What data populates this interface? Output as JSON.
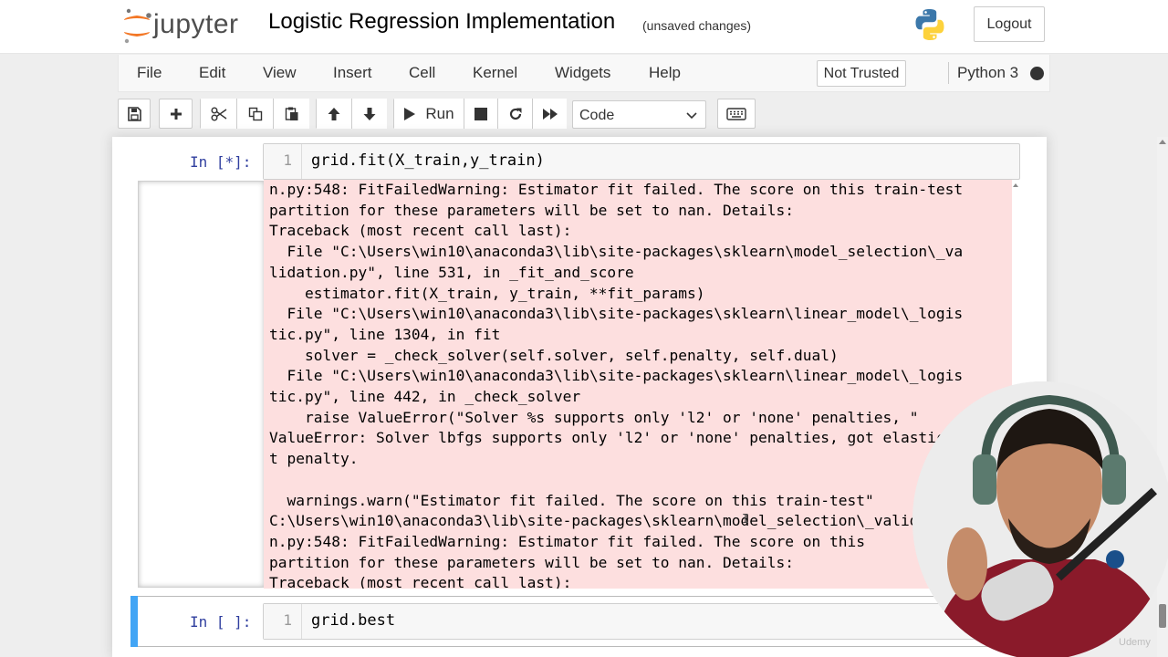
{
  "header": {
    "logo_text": "jupyter",
    "notebook_title": "Logistic Regression Implementation",
    "save_status": "(unsaved changes)",
    "logout_label": "Logout"
  },
  "menubar": {
    "items": [
      "File",
      "Edit",
      "View",
      "Insert",
      "Cell",
      "Kernel",
      "Widgets",
      "Help"
    ],
    "trust_label": "Not Trusted",
    "kernel_name": "Python 3",
    "kernel_status": "busy"
  },
  "toolbar": {
    "buttons": [
      "save-icon",
      "plus-icon",
      "cut-icon",
      "copy-icon",
      "paste-icon",
      "arrow-up-icon",
      "arrow-down-icon",
      "play-icon",
      "stop-icon",
      "restart-icon",
      "fast-forward-icon",
      "keyboard-icon"
    ],
    "run_label": "Run",
    "cell_type": "Code"
  },
  "cells": [
    {
      "prompt": "In [*]:",
      "line_number": "1",
      "code": "grid.fit(X_train,y_train)",
      "stderr": "n.py:548: FitFailedWarning: Estimator fit failed. The score on this train-test\npartition for these parameters will be set to nan. Details:\nTraceback (most recent call last):\n  File \"C:\\Users\\win10\\anaconda3\\lib\\site-packages\\sklearn\\model_selection\\_va\nlidation.py\", line 531, in _fit_and_score\n    estimator.fit(X_train, y_train, **fit_params)\n  File \"C:\\Users\\win10\\anaconda3\\lib\\site-packages\\sklearn\\linear_model\\_logis\ntic.py\", line 1304, in fit\n    solver = _check_solver(self.solver, self.penalty, self.dual)\n  File \"C:\\Users\\win10\\anaconda3\\lib\\site-packages\\sklearn\\linear_model\\_logis\ntic.py\", line 442, in _check_solver\n    raise ValueError(\"Solver %s supports only 'l2' or 'none' penalties, \"\nValueError: Solver lbfgs supports only 'l2' or 'none' penalties, got elastic\nt penalty.\n\n  warnings.warn(\"Estimator fit failed. The score on this train-test\"\nC:\\Users\\win10\\anaconda3\\lib\\site-packages\\sklearn\\model_selection\\_valida\nn.py:548: FitFailedWarning: Estimator fit failed. The score on this\npartition for these parameters will be set to nan. Details:\nTraceback (most recent call last):"
    },
    {
      "prompt": "In [ ]:",
      "line_number": "1",
      "code": "grid.best"
    }
  ],
  "overlay": {
    "watermark": "Udemy"
  },
  "colors": {
    "stderr_bg": "#fddfdf",
    "prompt_blue": "#303f9f",
    "selected_cell_bar": "#42a5f5",
    "jupyter_orange": "#f37726"
  }
}
